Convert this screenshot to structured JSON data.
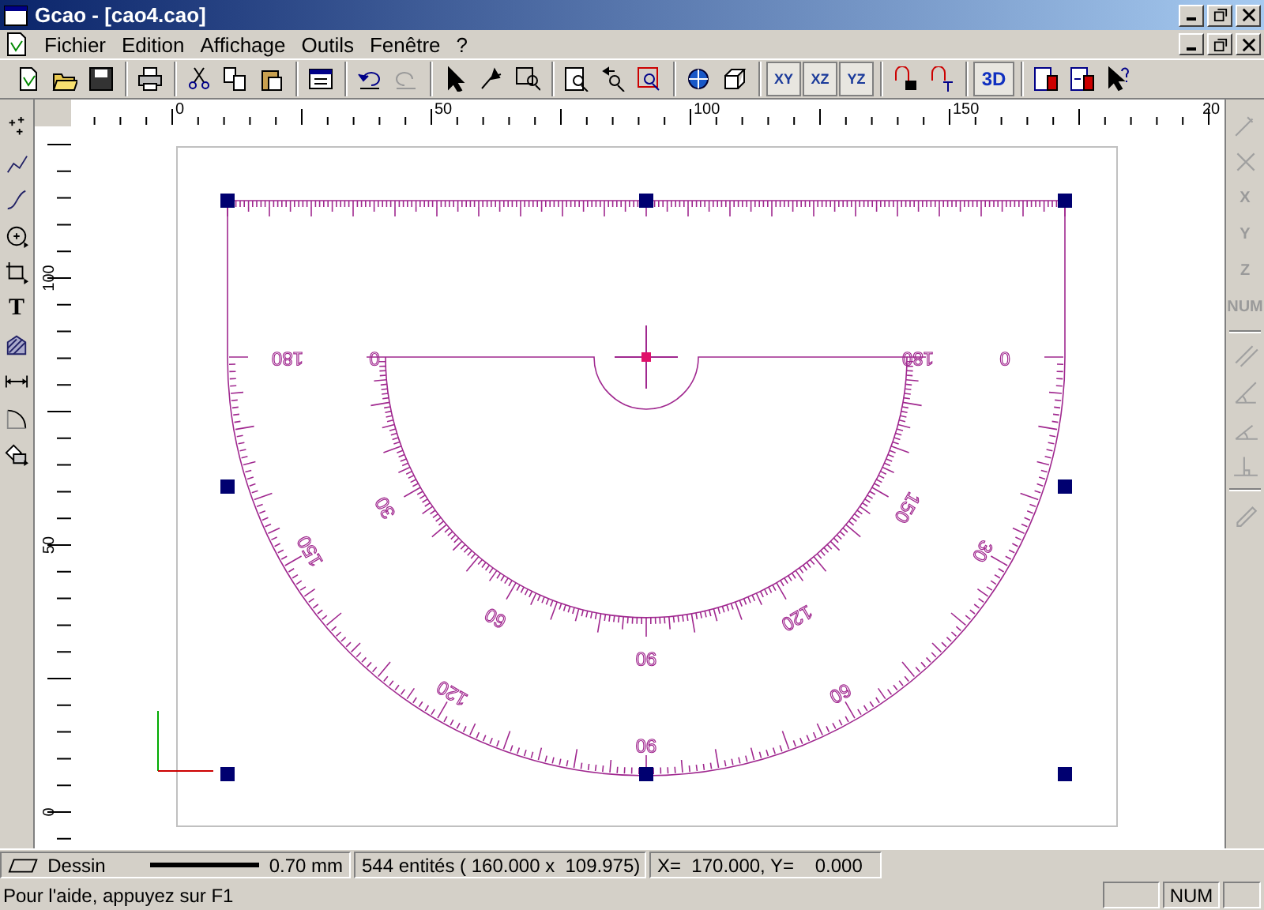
{
  "window": {
    "title": "Gcao - [cao4.cao]"
  },
  "menu": [
    "Fichier",
    "Edition",
    "Affichage",
    "Outils",
    "Fenêtre",
    "?"
  ],
  "view_buttons": [
    "XY",
    "XZ",
    "YZ"
  ],
  "mode_button": "3D",
  "left_toolbar": {
    "text_tool": "T"
  },
  "right_toolbar": {
    "disabled": true,
    "axis_labels": [
      "X",
      "Y",
      "Z",
      "NUM"
    ]
  },
  "rulers": {
    "horizontal": [
      "0",
      "50",
      "100",
      "150",
      "20"
    ],
    "vertical": [
      "100",
      "50",
      "0"
    ]
  },
  "drawing": {
    "outer_scale": [
      "180",
      "150",
      "120",
      "90",
      "60",
      "30",
      "0"
    ],
    "inner_scale": [
      "0",
      "30",
      "60",
      "90",
      "120",
      "150",
      "180"
    ]
  },
  "status_bar": {
    "layer": "Dessin",
    "line_width": "0.70 mm",
    "entities": "544 entités ( 160.000 x  109.975)",
    "coordinates": "X=  170.000, Y=    0.000",
    "help": "Pour l'aide, appuyez sur F1",
    "num_indicator": "NUM"
  }
}
